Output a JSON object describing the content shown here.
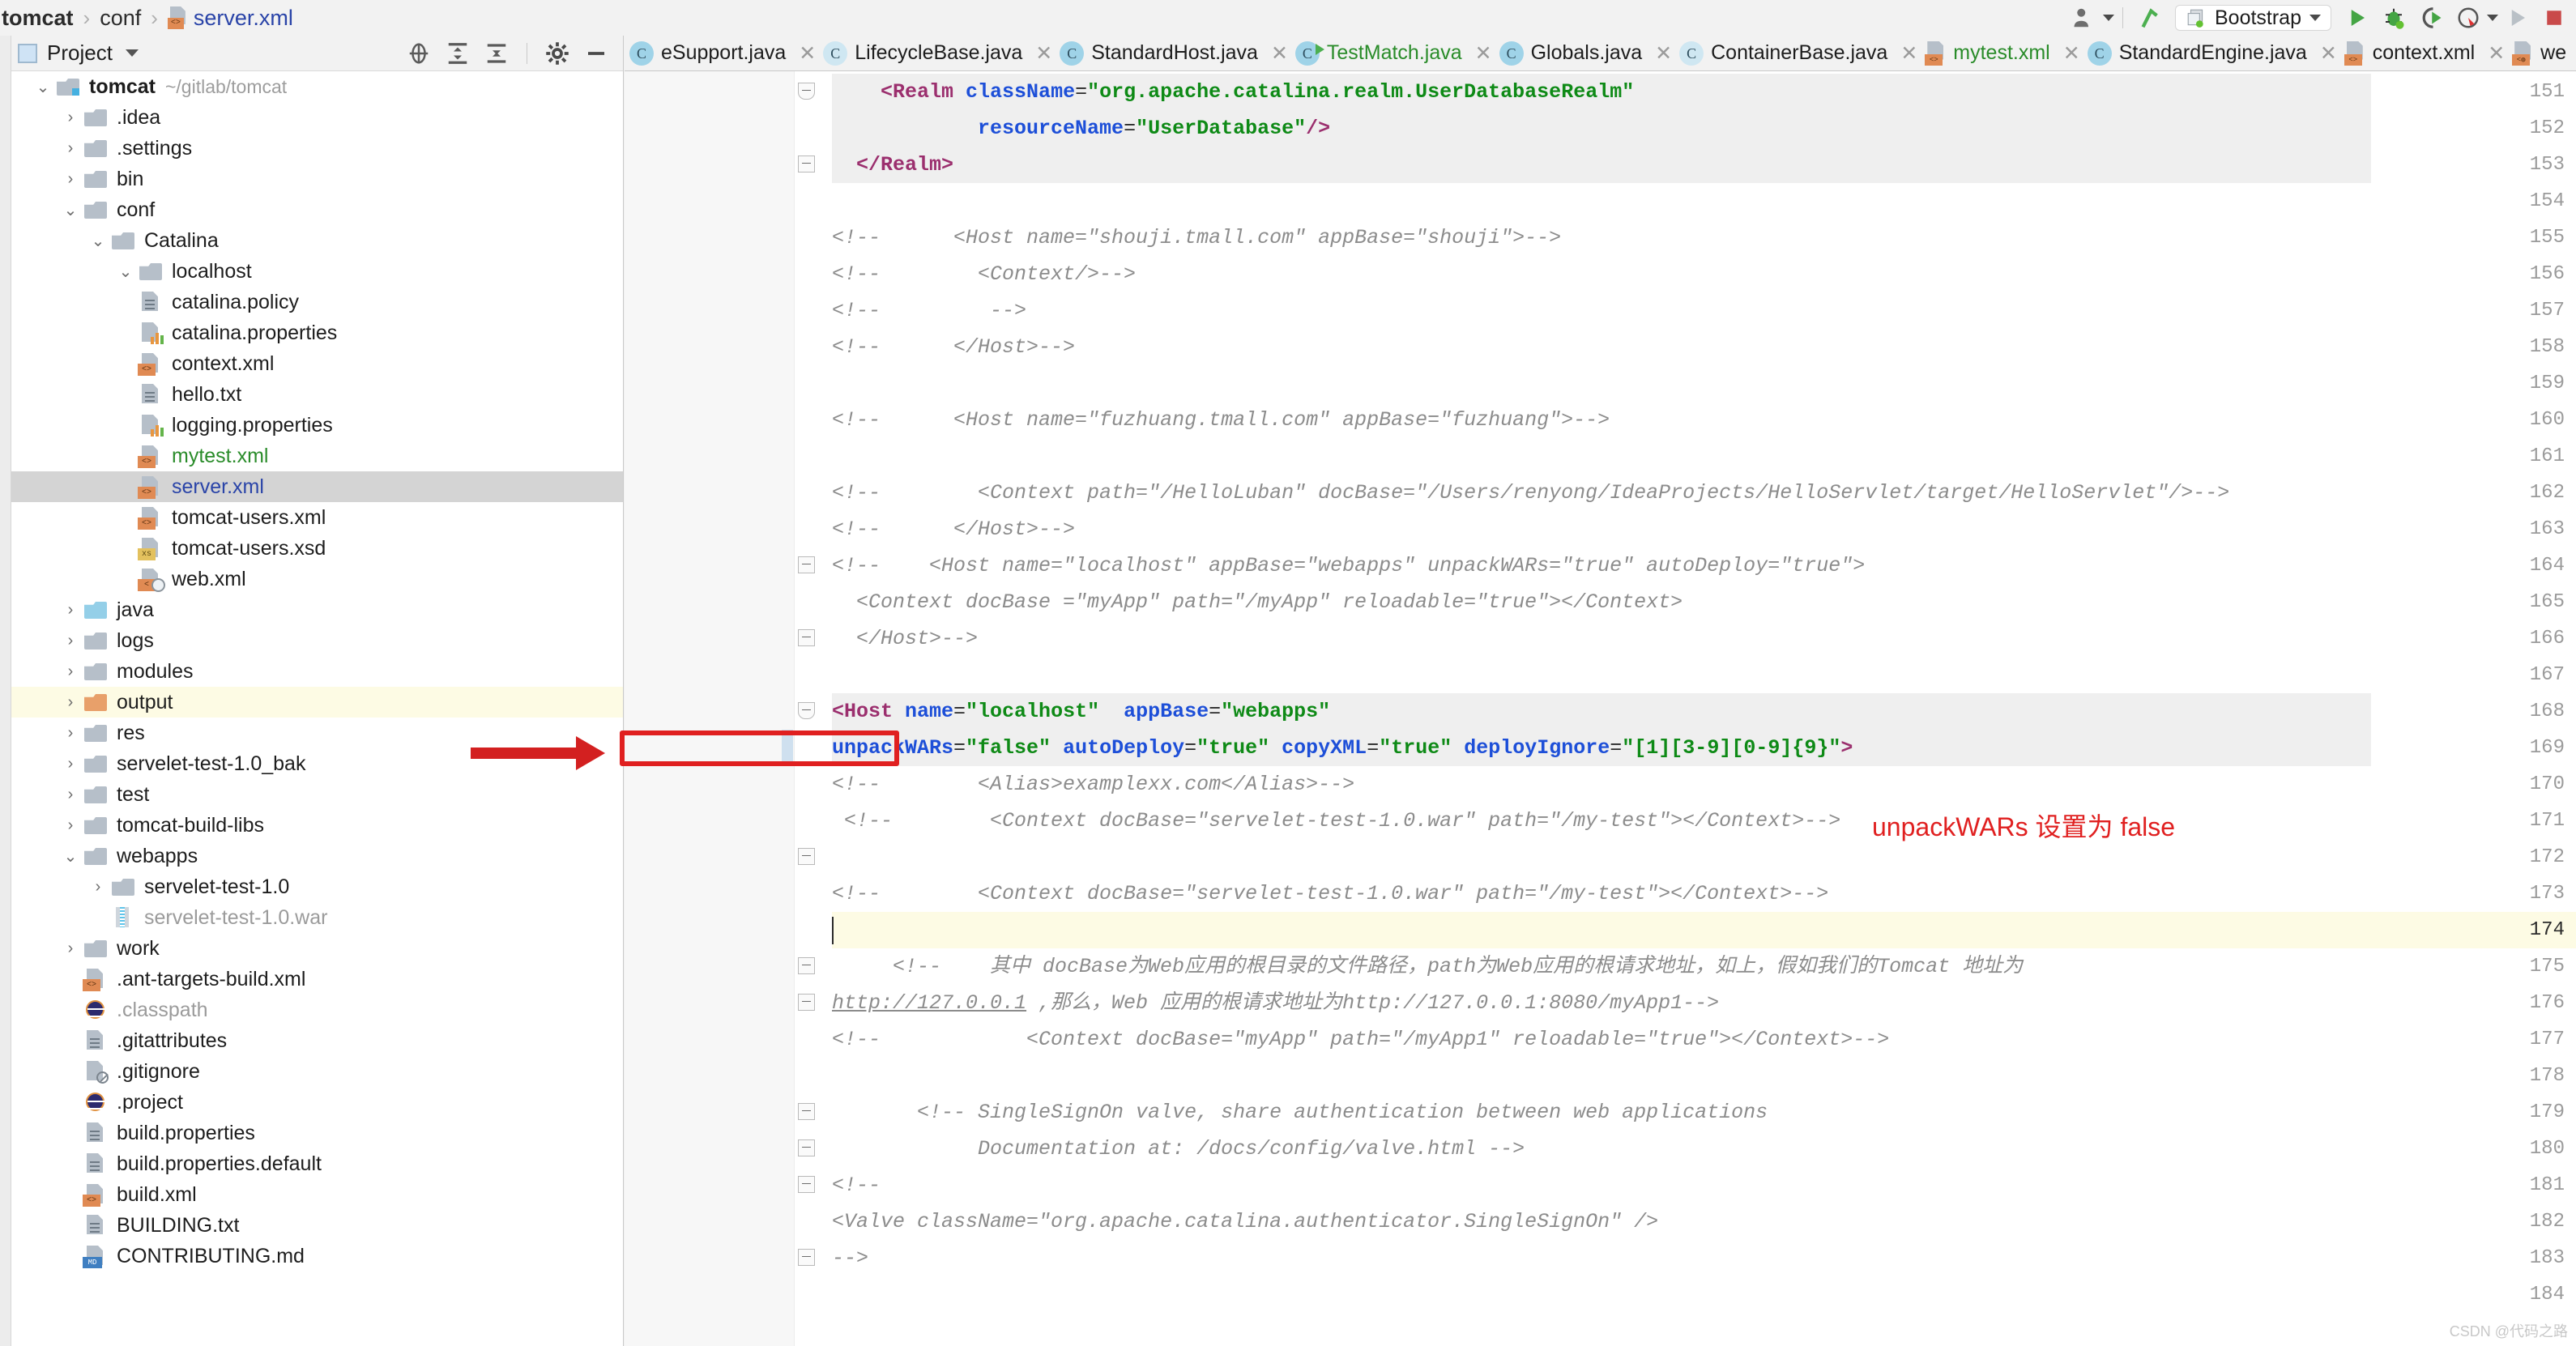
{
  "breadcrumb": {
    "project": "tomcat",
    "folder": "conf",
    "file": "server.xml",
    "separator": "›"
  },
  "toolbar": {
    "run_config_label": "Bootstrap",
    "icons": [
      "user-avatar-icon",
      "vcs-update-icon",
      "run-icon",
      "debug-icon",
      "run-coverage-icon",
      "profile-icon",
      "run-disabled-icon",
      "stop-icon"
    ]
  },
  "project_panel": {
    "title": "Project",
    "tools": [
      "locate-icon",
      "expand-all-icon",
      "collapse-all-icon",
      "settings-gear-icon",
      "hide-icon"
    ],
    "tree": [
      {
        "indent": 0,
        "arrow": "down",
        "icon": "module-folder",
        "label": "tomcat",
        "style": "bold",
        "path": "~/gitlab/tomcat",
        "state": "normal"
      },
      {
        "indent": 1,
        "arrow": "right",
        "icon": "folder",
        "label": ".idea",
        "style": "normal",
        "path": "",
        "state": "normal"
      },
      {
        "indent": 1,
        "arrow": "right",
        "icon": "folder",
        "label": ".settings",
        "style": "normal",
        "path": "",
        "state": "normal"
      },
      {
        "indent": 1,
        "arrow": "right",
        "icon": "folder",
        "label": "bin",
        "style": "normal",
        "path": "",
        "state": "normal"
      },
      {
        "indent": 1,
        "arrow": "down",
        "icon": "folder",
        "label": "conf",
        "style": "normal",
        "path": "",
        "state": "normal"
      },
      {
        "indent": 2,
        "arrow": "down",
        "icon": "folder",
        "label": "Catalina",
        "style": "normal",
        "path": "",
        "state": "normal"
      },
      {
        "indent": 3,
        "arrow": "down",
        "icon": "folder",
        "label": "localhost",
        "style": "normal",
        "path": "",
        "state": "normal"
      },
      {
        "indent": 3,
        "arrow": "none",
        "icon": "doc-text",
        "label": "catalina.policy",
        "style": "normal",
        "path": "",
        "state": "normal"
      },
      {
        "indent": 3,
        "arrow": "none",
        "icon": "doc-props",
        "label": "catalina.properties",
        "style": "normal",
        "path": "",
        "state": "normal"
      },
      {
        "indent": 3,
        "arrow": "none",
        "icon": "doc-xml",
        "label": "context.xml",
        "style": "normal",
        "path": "",
        "state": "normal"
      },
      {
        "indent": 3,
        "arrow": "none",
        "icon": "doc-text",
        "label": "hello.txt",
        "style": "normal",
        "path": "",
        "state": "normal"
      },
      {
        "indent": 3,
        "arrow": "none",
        "icon": "doc-props",
        "label": "logging.properties",
        "style": "normal",
        "path": "",
        "state": "normal"
      },
      {
        "indent": 3,
        "arrow": "none",
        "icon": "doc-xml",
        "label": "mytest.xml",
        "style": "green",
        "path": "",
        "state": "normal"
      },
      {
        "indent": 3,
        "arrow": "none",
        "icon": "doc-xml",
        "label": "server.xml",
        "style": "blue",
        "path": "",
        "state": "selected"
      },
      {
        "indent": 3,
        "arrow": "none",
        "icon": "doc-xml",
        "label": "tomcat-users.xml",
        "style": "normal",
        "path": "",
        "state": "normal"
      },
      {
        "indent": 3,
        "arrow": "none",
        "icon": "doc-xsd",
        "label": "tomcat-users.xsd",
        "style": "normal",
        "path": "",
        "state": "normal"
      },
      {
        "indent": 3,
        "arrow": "none",
        "icon": "doc-webxml",
        "label": "web.xml",
        "style": "normal",
        "path": "",
        "state": "normal"
      },
      {
        "indent": 1,
        "arrow": "right",
        "icon": "folder-source",
        "label": "java",
        "style": "normal",
        "path": "",
        "state": "normal"
      },
      {
        "indent": 1,
        "arrow": "right",
        "icon": "folder",
        "label": "logs",
        "style": "normal",
        "path": "",
        "state": "normal"
      },
      {
        "indent": 1,
        "arrow": "right",
        "icon": "folder",
        "label": "modules",
        "style": "normal",
        "path": "",
        "state": "normal"
      },
      {
        "indent": 1,
        "arrow": "right",
        "icon": "folder-excluded",
        "label": "output",
        "style": "normal",
        "path": "",
        "state": "highlighted"
      },
      {
        "indent": 1,
        "arrow": "right",
        "icon": "folder",
        "label": "res",
        "style": "normal",
        "path": "",
        "state": "normal"
      },
      {
        "indent": 1,
        "arrow": "right",
        "icon": "folder",
        "label": "servelet-test-1.0_bak",
        "style": "normal",
        "path": "",
        "state": "normal"
      },
      {
        "indent": 1,
        "arrow": "right",
        "icon": "folder",
        "label": "test",
        "style": "normal",
        "path": "",
        "state": "normal"
      },
      {
        "indent": 1,
        "arrow": "right",
        "icon": "folder",
        "label": "tomcat-build-libs",
        "style": "normal",
        "path": "",
        "state": "normal"
      },
      {
        "indent": 1,
        "arrow": "down",
        "icon": "folder",
        "label": "webapps",
        "style": "normal",
        "path": "",
        "state": "normal"
      },
      {
        "indent": 2,
        "arrow": "right",
        "icon": "folder",
        "label": "servelet-test-1.0",
        "style": "normal",
        "path": "",
        "state": "normal"
      },
      {
        "indent": 2,
        "arrow": "none",
        "icon": "archive",
        "label": "servelet-test-1.0.war",
        "style": "grey",
        "path": "",
        "state": "normal"
      },
      {
        "indent": 1,
        "arrow": "right",
        "icon": "folder",
        "label": "work",
        "style": "normal",
        "path": "",
        "state": "normal"
      },
      {
        "indent": 1,
        "arrow": "none",
        "icon": "doc-xml",
        "label": ".ant-targets-build.xml",
        "style": "normal",
        "path": "",
        "state": "normal"
      },
      {
        "indent": 1,
        "arrow": "none",
        "icon": "java-circle",
        "label": ".classpath",
        "style": "grey",
        "path": "",
        "state": "normal"
      },
      {
        "indent": 1,
        "arrow": "none",
        "icon": "doc-text",
        "label": ".gitattributes",
        "style": "normal",
        "path": "",
        "state": "normal"
      },
      {
        "indent": 1,
        "arrow": "none",
        "icon": "doc-ignore",
        "label": ".gitignore",
        "style": "normal",
        "path": "",
        "state": "normal"
      },
      {
        "indent": 1,
        "arrow": "none",
        "icon": "java-circle",
        "label": ".project",
        "style": "normal",
        "path": "",
        "state": "normal"
      },
      {
        "indent": 1,
        "arrow": "none",
        "icon": "doc-text",
        "label": "build.properties",
        "style": "normal",
        "path": "",
        "state": "normal"
      },
      {
        "indent": 1,
        "arrow": "none",
        "icon": "doc-text",
        "label": "build.properties.default",
        "style": "normal",
        "path": "",
        "state": "normal"
      },
      {
        "indent": 1,
        "arrow": "none",
        "icon": "doc-xml",
        "label": "build.xml",
        "style": "normal",
        "path": "",
        "state": "normal"
      },
      {
        "indent": 1,
        "arrow": "none",
        "icon": "doc-text",
        "label": "BUILDING.txt",
        "style": "normal",
        "path": "",
        "state": "normal"
      },
      {
        "indent": 1,
        "arrow": "none",
        "icon": "doc-md",
        "label": "CONTRIBUTING.md",
        "style": "normal",
        "path": "",
        "state": "normal"
      }
    ]
  },
  "editor_tabs": [
    {
      "label": "eSupport.java",
      "icon": "class-icon",
      "color": "normal",
      "truncated": true
    },
    {
      "label": "LifecycleBase.java",
      "icon": "abstract-class-icon",
      "color": "normal",
      "truncated": false
    },
    {
      "label": "StandardHost.java",
      "icon": "class-icon",
      "color": "normal",
      "truncated": false
    },
    {
      "label": "TestMatch.java",
      "icon": "runnable-class-icon",
      "color": "green",
      "truncated": false
    },
    {
      "label": "Globals.java",
      "icon": "class-icon",
      "color": "normal",
      "truncated": false
    },
    {
      "label": "ContainerBase.java",
      "icon": "abstract-class-icon",
      "color": "normal",
      "truncated": false
    },
    {
      "label": "mytest.xml",
      "icon": "xml-icon",
      "color": "green",
      "truncated": false
    },
    {
      "label": "StandardEngine.java",
      "icon": "class-icon",
      "color": "normal",
      "truncated": false
    },
    {
      "label": "context.xml",
      "icon": "xml-icon",
      "color": "normal",
      "truncated": false
    },
    {
      "label": "we",
      "icon": "webxml-icon",
      "color": "normal",
      "truncated": true
    }
  ],
  "editor": {
    "first_line_number": 151,
    "current_line": 174,
    "lines": [
      {
        "n": 151,
        "fold": "end-arrow",
        "highlight": "grey",
        "tokens": [
          {
            "t": "plain",
            "v": "    "
          },
          {
            "t": "tag",
            "v": "<Realm "
          },
          {
            "t": "attr",
            "v": "className"
          },
          {
            "t": "plain",
            "v": "="
          },
          {
            "t": "val",
            "v": "\"org.apache.catalina.realm.UserDatabaseRealm\""
          }
        ]
      },
      {
        "n": 152,
        "fold": "",
        "highlight": "grey",
        "tokens": [
          {
            "t": "plain",
            "v": "            "
          },
          {
            "t": "attr",
            "v": "resourceName"
          },
          {
            "t": "plain",
            "v": "="
          },
          {
            "t": "val",
            "v": "\"UserDatabase\""
          },
          {
            "t": "tag",
            "v": "/>"
          }
        ]
      },
      {
        "n": 153,
        "fold": "minus",
        "highlight": "grey",
        "tokens": [
          {
            "t": "plain",
            "v": "  "
          },
          {
            "t": "tag",
            "v": "</Realm>"
          }
        ]
      },
      {
        "n": 154,
        "fold": "",
        "highlight": "",
        "tokens": []
      },
      {
        "n": 155,
        "fold": "",
        "highlight": "",
        "tokens": [
          {
            "t": "cmt",
            "v": "<!--      <Host name=\"shouji.tmall.com\" appBase=\"shouji\">-->"
          }
        ]
      },
      {
        "n": 156,
        "fold": "",
        "highlight": "",
        "tokens": [
          {
            "t": "cmt",
            "v": "<!--        <Context/>-->"
          }
        ]
      },
      {
        "n": 157,
        "fold": "",
        "highlight": "",
        "tokens": [
          {
            "t": "cmt",
            "v": "<!--         -->"
          }
        ]
      },
      {
        "n": 158,
        "fold": "",
        "highlight": "",
        "tokens": [
          {
            "t": "cmt",
            "v": "<!--      </Host>-->"
          }
        ]
      },
      {
        "n": 159,
        "fold": "",
        "highlight": "",
        "tokens": []
      },
      {
        "n": 160,
        "fold": "",
        "highlight": "",
        "tokens": [
          {
            "t": "cmt",
            "v": "<!--      <Host name=\"fuzhuang.tmall.com\" appBase=\"fuzhuang\">-->"
          }
        ]
      },
      {
        "n": 161,
        "fold": "",
        "highlight": "",
        "tokens": []
      },
      {
        "n": 162,
        "fold": "",
        "highlight": "",
        "tokens": [
          {
            "t": "cmt",
            "v": "<!--        <Context path=\"/HelloLuban\" docBase=\"/Users/renyong/IdeaProjects/HelloServlet/target/HelloServlet\"/>-->"
          }
        ]
      },
      {
        "n": 163,
        "fold": "",
        "highlight": "",
        "tokens": [
          {
            "t": "cmt",
            "v": "<!--      </Host>-->"
          }
        ]
      },
      {
        "n": 164,
        "fold": "minus",
        "highlight": "",
        "tokens": [
          {
            "t": "cmt",
            "v": "<!--    <Host name=\"localhost\" appBase=\"webapps\" unpackWARs=\"true\" autoDeploy=\"true\">"
          }
        ]
      },
      {
        "n": 165,
        "fold": "",
        "highlight": "",
        "tokens": [
          {
            "t": "cmt",
            "v": "  <Context docBase =\"myApp\" path=\"/myApp\" reloadable=\"true\"></Context>"
          }
        ]
      },
      {
        "n": 166,
        "fold": "minus",
        "highlight": "",
        "tokens": [
          {
            "t": "cmt",
            "v": "  </Host>-->"
          }
        ]
      },
      {
        "n": 167,
        "fold": "",
        "highlight": "",
        "tokens": []
      },
      {
        "n": 168,
        "fold": "end-arrow",
        "highlight": "grey",
        "tokens": [
          {
            "t": "tag",
            "v": "<Host "
          },
          {
            "t": "attr",
            "v": "name"
          },
          {
            "t": "plain",
            "v": "="
          },
          {
            "t": "val",
            "v": "\"localhost\""
          },
          {
            "t": "plain",
            "v": "  "
          },
          {
            "t": "attr",
            "v": "appBase"
          },
          {
            "t": "plain",
            "v": "="
          },
          {
            "t": "val",
            "v": "\"webapps\""
          }
        ]
      },
      {
        "n": 169,
        "fold": "",
        "highlight": "grey",
        "gutter_mark": "blue",
        "tokens": [
          {
            "t": "attr",
            "v": "unpackWARs"
          },
          {
            "t": "plain",
            "v": "="
          },
          {
            "t": "val",
            "v": "\"false\""
          },
          {
            "t": "plain",
            "v": " "
          },
          {
            "t": "attr",
            "v": "autoDeploy"
          },
          {
            "t": "plain",
            "v": "="
          },
          {
            "t": "val",
            "v": "\"true\""
          },
          {
            "t": "plain",
            "v": " "
          },
          {
            "t": "attr",
            "v": "copyXML"
          },
          {
            "t": "plain",
            "v": "="
          },
          {
            "t": "val",
            "v": "\"true\""
          },
          {
            "t": "plain",
            "v": " "
          },
          {
            "t": "attr",
            "v": "deployIgnore"
          },
          {
            "t": "plain",
            "v": "="
          },
          {
            "t": "val",
            "v": "\"[1][3-9][0-9]{9}\""
          },
          {
            "t": "tag",
            "v": ">"
          }
        ]
      },
      {
        "n": 170,
        "fold": "",
        "highlight": "",
        "tokens": [
          {
            "t": "cmt",
            "v": "<!--        <Alias>examplexx.com</Alias>-->"
          }
        ]
      },
      {
        "n": 171,
        "fold": "",
        "highlight": "",
        "tokens": [
          {
            "t": "cmt",
            "v": " <!--        <Context docBase=\"servelet-test-1.0.war\" path=\"/my-test\"></Context>-->"
          }
        ]
      },
      {
        "n": 172,
        "fold": "collapsed",
        "highlight": "",
        "tokens": []
      },
      {
        "n": 173,
        "fold": "",
        "highlight": "",
        "tokens": [
          {
            "t": "cmt",
            "v": "<!--        <Context docBase=\"servelet-test-1.0.war\" path=\"/my-test\"></Context>-->"
          }
        ]
      },
      {
        "n": 174,
        "fold": "",
        "highlight": "current",
        "tokens": []
      },
      {
        "n": 175,
        "fold": "minus",
        "highlight": "",
        "tokens": [
          {
            "t": "cmt",
            "v": "     <!--    其中 docBase为Web应用的根目录的文件路径，path为Web应用的根请求地址，如上，假如我们的Tomcat 地址为"
          }
        ]
      },
      {
        "n": 176,
        "fold": "minus",
        "highlight": "",
        "tokens": [
          {
            "t": "link",
            "v": "http://127.0.0.1"
          },
          {
            "t": "cmt",
            "v": " ,那么，Web 应用的根请求地址为http://127.0.0.1:8080/myApp1-->"
          }
        ]
      },
      {
        "n": 177,
        "fold": "",
        "highlight": "",
        "tokens": [
          {
            "t": "cmt",
            "v": "<!--            <Context docBase=\"myApp\" path=\"/myApp1\" reloadable=\"true\"></Context>-->"
          }
        ]
      },
      {
        "n": 178,
        "fold": "",
        "highlight": "",
        "tokens": []
      },
      {
        "n": 179,
        "fold": "minus",
        "highlight": "",
        "tokens": [
          {
            "t": "cmt",
            "v": "       <!-- SingleSignOn valve, share authentication between web applications"
          }
        ]
      },
      {
        "n": 180,
        "fold": "minus",
        "highlight": "",
        "tokens": [
          {
            "t": "cmt",
            "v": "            Documentation at: /docs/config/valve.html -->"
          }
        ]
      },
      {
        "n": 181,
        "fold": "minus",
        "highlight": "",
        "tokens": [
          {
            "t": "cmt",
            "v": "<!--"
          }
        ]
      },
      {
        "n": 182,
        "fold": "",
        "highlight": "",
        "tokens": [
          {
            "t": "cmt",
            "v": "<Valve className=\"org.apache.catalina.authenticator.SingleSignOn\" />"
          }
        ]
      },
      {
        "n": 183,
        "fold": "minus",
        "highlight": "",
        "tokens": [
          {
            "t": "cmt",
            "v": "-->"
          }
        ]
      },
      {
        "n": 184,
        "fold": "",
        "highlight": "",
        "tokens": []
      }
    ]
  },
  "annotations": {
    "red_box_target": "unpackWARs=\"false\"",
    "callout_text": "unpackWARs 设置为 false",
    "arrow": "red-arrow-pointing-right"
  },
  "watermark": "CSDN @代码之路",
  "colors": {
    "accent_red": "#e02020",
    "tag": "#9b2f6e",
    "attribute": "#1d4fd8",
    "value": "#0e8a16",
    "comment": "#8c8c8c",
    "link_blue": "#2a44a8",
    "vcs_green": "#2a8c2a",
    "selection_grey": "#d4d4d4",
    "current_line_yellow": "#fdfbe4"
  }
}
